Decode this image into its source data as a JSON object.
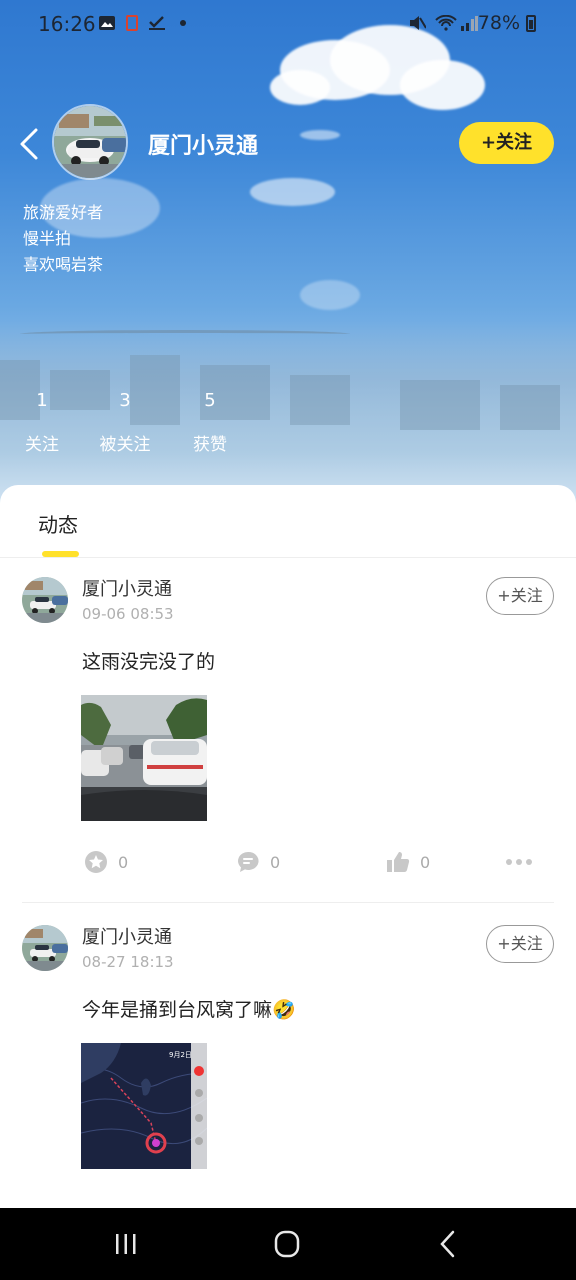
{
  "status_bar": {
    "time": "16:26",
    "battery": "78%"
  },
  "profile": {
    "name": "厦门小灵通",
    "follow_label": "+关注",
    "bio": [
      "旅游爱好者",
      "慢半拍",
      "喜欢喝岩茶"
    ],
    "stats": [
      {
        "value": "1",
        "label": "关注"
      },
      {
        "value": "3",
        "label": "被关注"
      },
      {
        "value": "5",
        "label": "获赞"
      }
    ]
  },
  "tabs": {
    "active": "动态"
  },
  "posts": [
    {
      "author": "厦门小灵通",
      "time": "09-06 08:53",
      "follow_label": "+关注",
      "text": "这雨没完没了的",
      "image": "rainy-traffic-photo",
      "favorites": "0",
      "comments": "0",
      "likes": "0"
    },
    {
      "author": "厦门小灵通",
      "time": "08-27 18:13",
      "follow_label": "+关注",
      "text": "今年是捅到台风窝了嘛🤣",
      "image": "typhoon-map-screenshot",
      "map_date": "9月2日"
    }
  ],
  "colors": {
    "accent": "#ffe12b",
    "sky": "#3d87d8"
  }
}
